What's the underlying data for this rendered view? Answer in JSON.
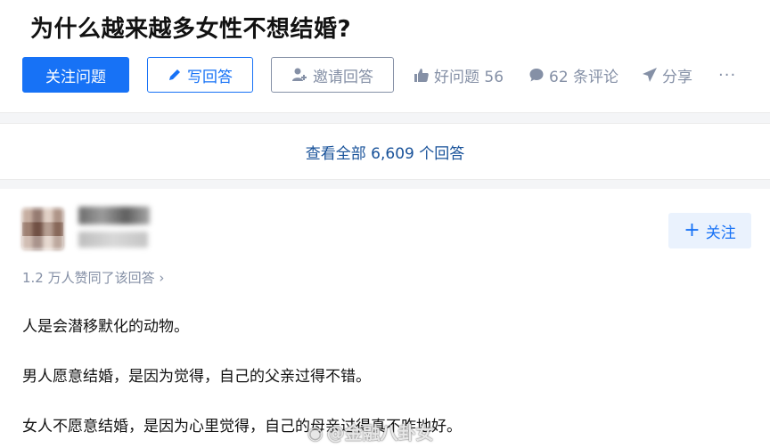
{
  "question": {
    "title": "为什么越来越多女性不想结婚?"
  },
  "actions": {
    "follow_label": "关注问题",
    "write_label": "写回答",
    "invite_label": "邀请回答",
    "good_question_label": "好问题 56",
    "comments_label": "62 条评论",
    "share_label": "分享",
    "more_label": "···"
  },
  "view_all": {
    "label": "查看全部 6,609 个回答"
  },
  "answer": {
    "follow_label": "关注",
    "votes_label": "1.2 万人赞同了该回答 ›",
    "paragraphs": [
      "人是会潜移默化的动物。",
      "男人愿意结婚，是因为觉得，自己的父亲过得不错。",
      "女人不愿意结婚，是因为心里觉得，自己的母亲过得真不咋地好。"
    ]
  },
  "watermark": {
    "text": "@金融八卦女"
  },
  "colors": {
    "brand_blue": "#1772f6",
    "link_blue": "#175199",
    "muted_gray": "#8590a6"
  }
}
